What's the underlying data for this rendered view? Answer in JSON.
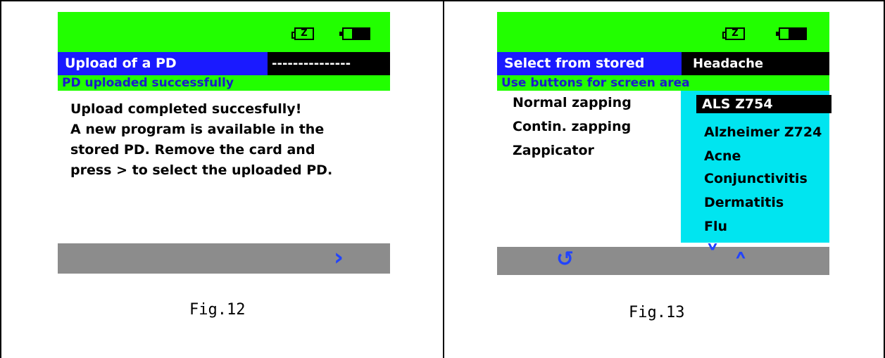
{
  "fig12": {
    "title": "Upload of a PD",
    "value": "---------------",
    "status": "PD uploaded successfully",
    "message": [
      "Upload completed succesfully!",
      "A new program is available in the",
      "stored PD. Remove the card and",
      "press >  to select the uploaded PD."
    ],
    "caption": "Fig.12"
  },
  "fig13": {
    "title": "Select from stored",
    "value": "Headache",
    "status": "Use buttons for screen area",
    "modes": [
      "Normal zapping",
      "Contin. zapping",
      "Zappicator"
    ],
    "programs": [
      "ALS Z754",
      "Alzheimer Z724",
      "Acne",
      "Conjunctivitis",
      "Dermatitis",
      "Flu"
    ],
    "selected_program": "ALS Z754",
    "caption": "Fig.13"
  },
  "icons": {
    "z_icon_label": "Z",
    "back": "↺",
    "next": "›",
    "down": "˅",
    "up": "˄"
  },
  "colors": {
    "green_bar": "#22ff00",
    "title_blue": "#1a1aff",
    "status_text": "#1a1acc",
    "list_cyan": "#00e5f0",
    "bottom_gray": "#8c8c8c",
    "nav_blue": "#2244ff"
  }
}
